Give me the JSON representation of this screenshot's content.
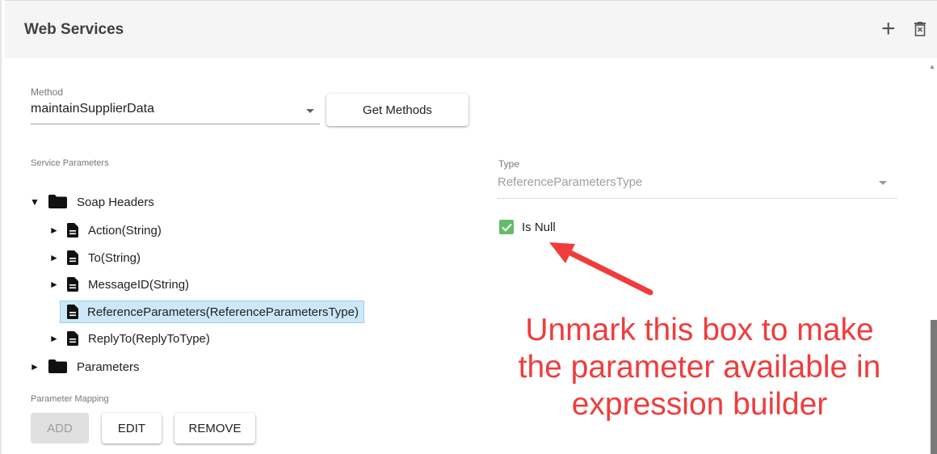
{
  "header": {
    "title": "Web Services",
    "add_icon": "plus-icon",
    "delete_icon": "trash-icon"
  },
  "method": {
    "label": "Method",
    "value": "maintainSupplierData",
    "get_button": "Get Methods"
  },
  "service_params": {
    "label": "Service Parameters",
    "tree": {
      "soap_headers": "Soap Headers",
      "items": [
        "Action(String)",
        "To(String)",
        "MessageID(String)",
        "ReferenceParameters(ReferenceParametersType)",
        "ReplyTo(ReplyToType)"
      ],
      "parameters": "Parameters"
    }
  },
  "type_field": {
    "label": "Type",
    "value": "ReferenceParametersType"
  },
  "is_null": {
    "label": "Is Null",
    "checked": true
  },
  "mapping": {
    "label": "Parameter Mapping",
    "add": "ADD",
    "edit": "EDIT",
    "remove": "REMOVE"
  },
  "annotation": {
    "line1": "Unmark this box to make",
    "line2": "the parameter available in",
    "line3": "expression builder",
    "color": "#f03c3c"
  },
  "colors": {
    "checkbox": "#66bb6a",
    "selection": "#cce8f8"
  }
}
